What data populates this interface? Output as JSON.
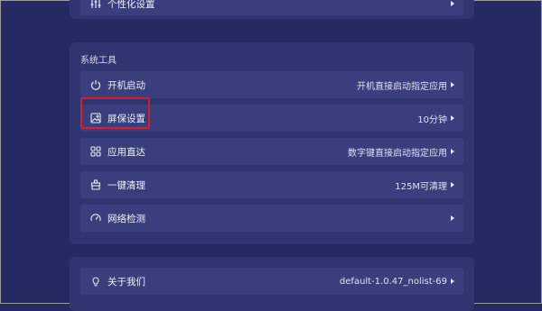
{
  "top_item": {
    "label": "个性化设置"
  },
  "system_tools": {
    "title": "系统工具",
    "items": [
      {
        "label": "开机启动",
        "value": "开机直接启动指定应用",
        "icon": "power-icon"
      },
      {
        "label": "屏保设置",
        "value": "10分钟",
        "icon": "image-icon"
      },
      {
        "label": "应用直达",
        "value": "数字键直接启动指定应用",
        "icon": "grid-icon"
      },
      {
        "label": "一键清理",
        "value": "125M可清理",
        "icon": "broom-icon"
      },
      {
        "label": "网络检测",
        "value": "",
        "icon": "speedometer-icon"
      }
    ]
  },
  "about": {
    "label": "关于我们",
    "value": "default-1.0.47_nolist-69",
    "icon": "bulb-icon"
  },
  "colors": {
    "background": "#252b62",
    "panel": "#2f3570",
    "row": "#383f7c",
    "highlight": "#d71f25"
  }
}
